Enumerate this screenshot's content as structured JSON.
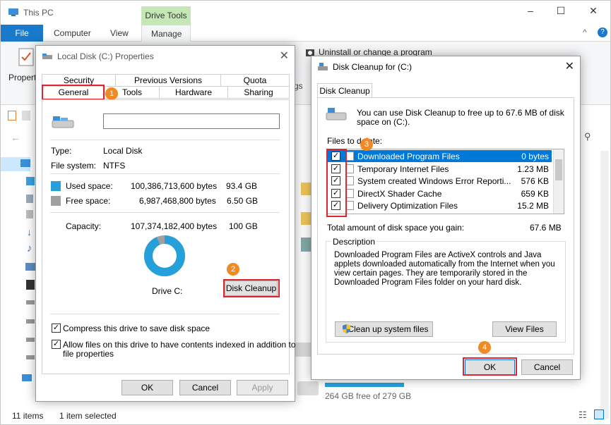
{
  "explorer": {
    "title": "This PC",
    "context_tab": "Drive Tools",
    "tabs": [
      "File",
      "Computer",
      "View",
      "Manage"
    ],
    "ribbon_items": [
      "Uninstall or change a program"
    ],
    "ribbon_left_label": "Propert",
    "ribbon_gs": "gs",
    "storage_text": "264 GB free of 279 GB",
    "status": {
      "items": "11 items",
      "selected": "1 item selected"
    },
    "window_controls": [
      "–",
      "☐",
      "✕"
    ]
  },
  "properties": {
    "title": "Local Disk (C:) Properties",
    "tabs_top": [
      "Security",
      "Previous Versions",
      "Quota"
    ],
    "tabs_bottom": [
      "General",
      "Tools",
      "Hardware",
      "Sharing"
    ],
    "name_value": "",
    "type_label": "Type:",
    "type_value": "Local Disk",
    "fs_label": "File system:",
    "fs_value": "NTFS",
    "used_label": "Used space:",
    "used_bytes": "100,386,713,600 bytes",
    "used_gb": "93.4 GB",
    "free_label": "Free space:",
    "free_bytes": "6,987,468,800 bytes",
    "free_gb": "6.50 GB",
    "cap_label": "Capacity:",
    "cap_bytes": "107,374,182,400 bytes",
    "cap_gb": "100 GB",
    "used_fraction": 0.935,
    "drive_label": "Drive C:",
    "cleanup_button": "Disk Cleanup",
    "compress_label": "Compress this drive to save disk space",
    "index_label_1": "Allow files on this drive to have contents indexed in addition to",
    "index_label_2": "file properties",
    "ok": "OK",
    "cancel": "Cancel",
    "apply": "Apply",
    "colors": {
      "used": "#26a0da",
      "free": "#a0a0a0"
    }
  },
  "cleanup": {
    "title": "Disk Cleanup for  (C:)",
    "tab": "Disk Cleanup",
    "intro_1": "You can use Disk Cleanup to free up to 67.6 MB of disk",
    "intro_2": "space on  (C:).",
    "files_label": "Files to delete:",
    "files": [
      {
        "name": "Downloaded Program Files",
        "size": "0 bytes",
        "checked": true,
        "selected": true
      },
      {
        "name": "Temporary Internet Files",
        "size": "1.23 MB",
        "checked": true,
        "selected": false
      },
      {
        "name": "System created Windows Error Reporti...",
        "size": "576 KB",
        "checked": true,
        "selected": false
      },
      {
        "name": "DirectX Shader Cache",
        "size": "659 KB",
        "checked": true,
        "selected": false
      },
      {
        "name": "Delivery Optimization Files",
        "size": "15.2 MB",
        "checked": true,
        "selected": false
      }
    ],
    "total_label": "Total amount of disk space you gain:",
    "total_value": "67.6 MB",
    "description_title": "Description",
    "description": "Downloaded Program Files are ActiveX controls and Java applets downloaded automatically from the Internet when you view certain pages. They are temporarily stored in the Downloaded Program Files folder on your hard disk.",
    "cleanup_system": "Clean up system files",
    "view_files": "View Files",
    "ok": "OK",
    "cancel": "Cancel"
  },
  "badges": [
    "1",
    "2",
    "3",
    "4"
  ]
}
